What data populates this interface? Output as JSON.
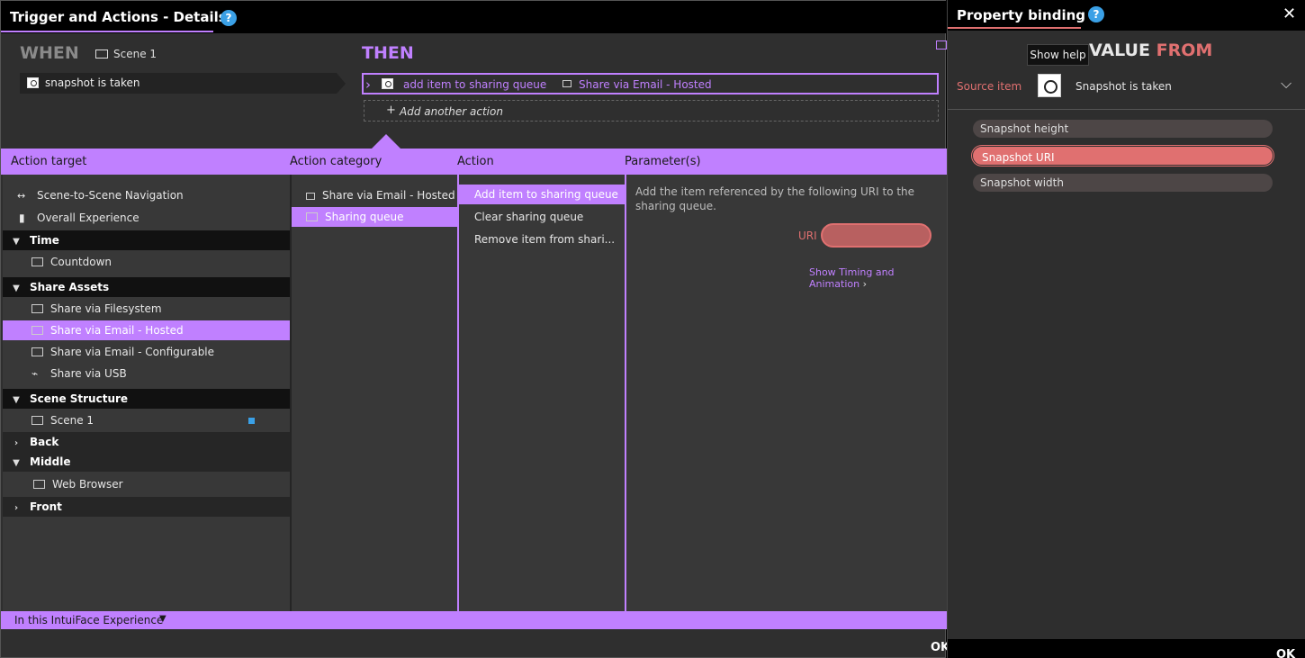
{
  "main": {
    "title": "Trigger and Actions - Details",
    "help": "?",
    "when_label": "WHEN",
    "scene_scope": "Scene 1",
    "trigger": "snapshot is taken",
    "then_label": "THEN",
    "action": {
      "name": "add item to sharing queue",
      "target": "Share via Email - Hosted"
    },
    "add_action": "Add another action",
    "columns": {
      "action_target": "Action target",
      "action_category": "Action category",
      "action": "Action",
      "parameters": "Parameter(s)"
    },
    "targets": [
      {
        "label": "Scene-to-Scene Navigation",
        "type": "item"
      },
      {
        "label": "Overall Experience",
        "type": "item"
      },
      {
        "label": "Time",
        "type": "group",
        "expanded": true
      },
      {
        "label": "Countdown",
        "type": "item"
      },
      {
        "label": "Share Assets",
        "type": "group",
        "expanded": true
      },
      {
        "label": "Share via Filesystem",
        "type": "item"
      },
      {
        "label": "Share via Email - Hosted",
        "type": "item",
        "selected": true
      },
      {
        "label": "Share via Email - Configurable",
        "type": "item"
      },
      {
        "label": "Share via USB",
        "type": "item"
      },
      {
        "label": "Scene Structure",
        "type": "group",
        "expanded": true
      },
      {
        "label": "Scene 1",
        "type": "item"
      },
      {
        "label": "Back",
        "type": "group",
        "expanded": false
      },
      {
        "label": "Middle",
        "type": "group",
        "expanded": true
      },
      {
        "label": "Web Browser",
        "type": "item"
      },
      {
        "label": "Front",
        "type": "group",
        "expanded": false
      }
    ],
    "categories": [
      {
        "label": "Share via Email - Hosted"
      },
      {
        "label": "Sharing queue",
        "selected": true
      }
    ],
    "actions": [
      {
        "label": "Add item to sharing queue",
        "selected": true
      },
      {
        "label": "Clear sharing queue"
      },
      {
        "label": "Remove item from shari..."
      }
    ],
    "param_desc": "Add the item referenced by the following URI to the sharing queue.",
    "uri_label": "URI",
    "timing_link": "Show Timing and Animation",
    "footer": "In this IntuiFace Experience",
    "ok": "OK"
  },
  "panel": {
    "title": "Property binding",
    "help": "?",
    "close": "✕",
    "tooltip": "Show help",
    "value_word": "VALUE",
    "from_word": "FROM",
    "source_label": "Source item",
    "source_value": "Snapshot is taken",
    "properties": [
      {
        "label": "Snapshot height"
      },
      {
        "label": "Snapshot URI",
        "selected": true
      },
      {
        "label": "Snapshot width"
      }
    ],
    "ok": "OK"
  },
  "colors": {
    "accent": "#c080ff",
    "binding": "#e07070",
    "help": "#3aa0e6"
  }
}
